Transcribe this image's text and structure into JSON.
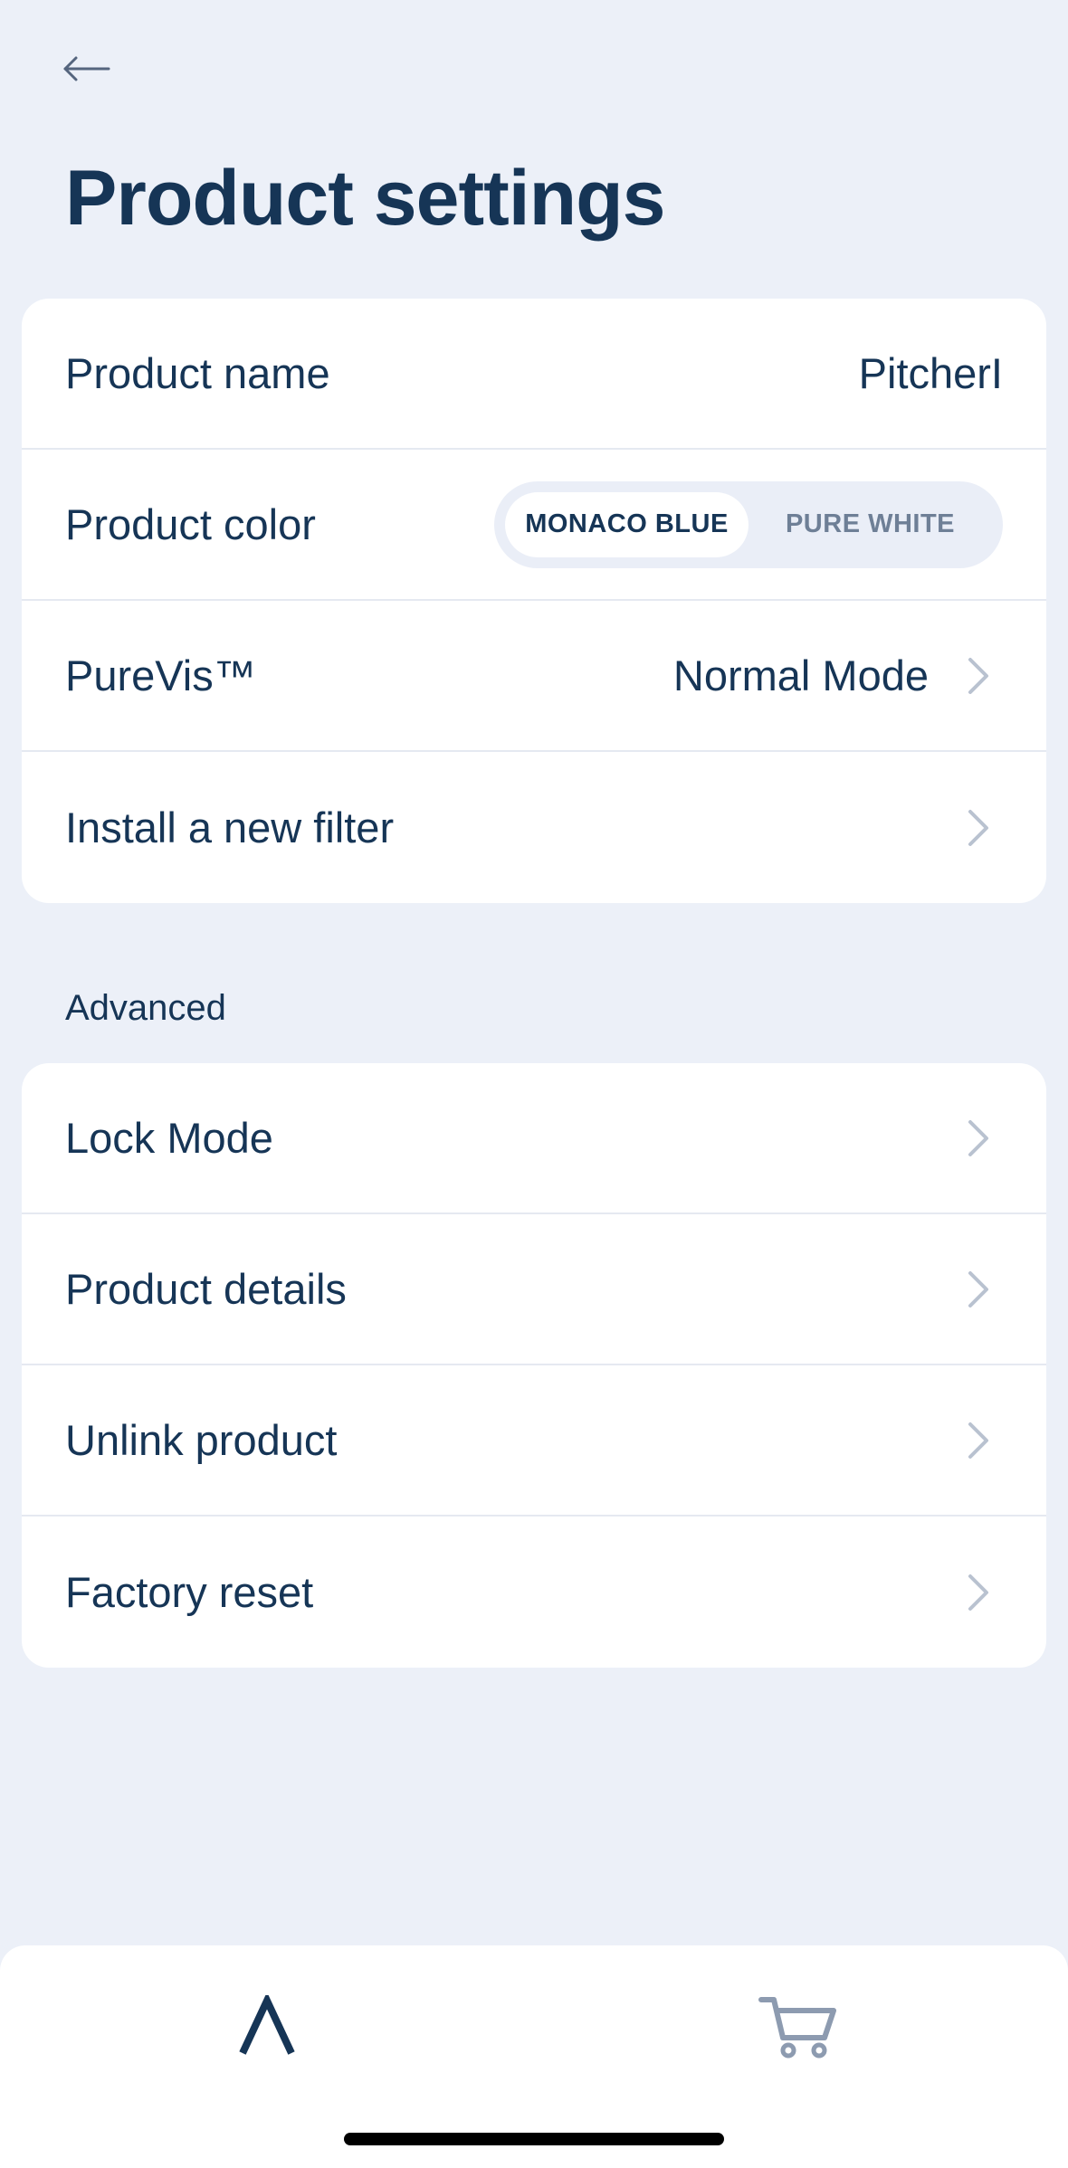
{
  "header": {
    "back_icon": "arrow-left-icon",
    "title": "Product settings"
  },
  "main_settings": {
    "product_name": {
      "label": "Product name",
      "value": "PitcherI"
    },
    "product_color": {
      "label": "Product color",
      "options": [
        "MONACO BLUE",
        "PURE WHITE"
      ],
      "selected": "MONACO BLUE"
    },
    "purevis": {
      "label": "PureVis™",
      "value": "Normal Mode"
    },
    "install_filter": {
      "label": "Install a new filter"
    }
  },
  "advanced": {
    "section_label": "Advanced",
    "items": [
      {
        "label": "Lock Mode"
      },
      {
        "label": "Product details"
      },
      {
        "label": "Unlink product"
      },
      {
        "label": "Factory reset"
      }
    ]
  },
  "bottom_nav": {
    "items": [
      {
        "icon": "lambda-home-icon",
        "active": true
      },
      {
        "icon": "cart-icon",
        "active": false
      }
    ]
  },
  "colors": {
    "background": "#ecf0f8",
    "card": "#ffffff",
    "text": "#163556",
    "muted": "#6e7f96",
    "chevron": "#b9c2d0"
  }
}
